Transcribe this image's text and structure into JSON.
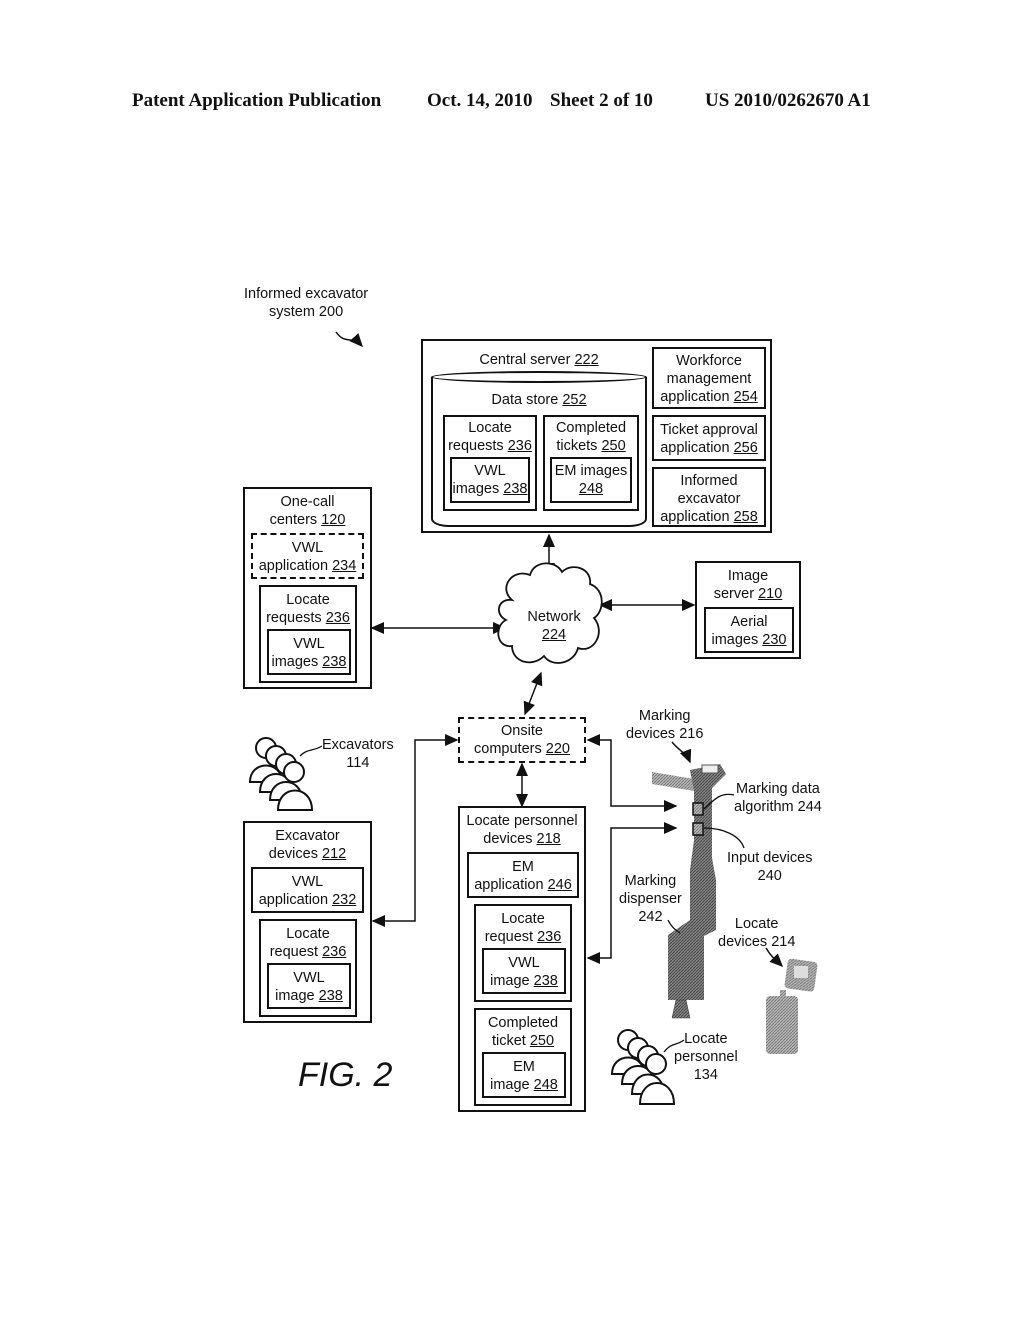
{
  "header": {
    "left": "Patent Application Publication",
    "date": "Oct. 14, 2010",
    "sheet": "Sheet 2 of 10",
    "number": "US 2010/0262670 A1"
  },
  "system_label": {
    "line1": "Informed excavator",
    "line2": "system 200"
  },
  "central_server": {
    "title": "Central server",
    "ref": "222",
    "data_store": {
      "title": "Data store",
      "ref": "252"
    },
    "locate_requests": {
      "line1": "Locate",
      "line2": "requests",
      "ref": "236"
    },
    "vwl_images": {
      "line1": "VWL",
      "line2": "images",
      "ref": "238"
    },
    "completed_tickets": {
      "line1": "Completed",
      "line2": "tickets",
      "ref": "250"
    },
    "em_images": {
      "line1": "EM images",
      "ref": "248"
    },
    "workforce": {
      "line1": "Workforce",
      "line2": "management",
      "line3": "application",
      "ref": "254"
    },
    "ticket_approval": {
      "line1": "Ticket approval",
      "line2": "application",
      "ref": "256"
    },
    "informed_excavator": {
      "line1": "Informed",
      "line2": "excavator",
      "line3": "application",
      "ref": "258"
    }
  },
  "one_call": {
    "line1": "One-call",
    "line2": "centers",
    "ref": "120",
    "vwl_app": {
      "line1": "VWL",
      "line2": "application",
      "ref": "234"
    },
    "locate_requests": {
      "line1": "Locate",
      "line2": "requests",
      "ref": "236"
    },
    "vwl_images": {
      "line1": "VWL",
      "line2": "images",
      "ref": "238"
    }
  },
  "network": {
    "line1": "Network",
    "ref": "224"
  },
  "image_server": {
    "line1": "Image",
    "line2": "server",
    "ref": "210",
    "aerial": {
      "line1": "Aerial",
      "line2": "images",
      "ref": "230"
    }
  },
  "onsite": {
    "line1": "Onsite",
    "line2": "computers",
    "ref": "220"
  },
  "excavators": {
    "line1": "Excavators",
    "line2": "114"
  },
  "excavator_devices": {
    "line1": "Excavator",
    "line2": "devices",
    "ref": "212",
    "vwl_app": {
      "line1": "VWL",
      "line2": "application",
      "ref": "232"
    },
    "locate_request": {
      "line1": "Locate",
      "line2": "request",
      "ref": "236"
    },
    "vwl_image": {
      "line1": "VWL",
      "line2": "image",
      "ref": "238"
    }
  },
  "locate_personnel_devices": {
    "line1": "Locate personnel",
    "line2": "devices",
    "ref": "218",
    "em_app": {
      "line1": "EM",
      "line2": "application",
      "ref": "246"
    },
    "locate_request": {
      "line1": "Locate",
      "line2": "request",
      "ref": "236"
    },
    "vwl_image": {
      "line1": "VWL",
      "line2": "image",
      "ref": "238"
    },
    "completed_ticket": {
      "line1": "Completed",
      "line2": "ticket",
      "ref": "250"
    },
    "em_image": {
      "line1": "EM",
      "line2": "image",
      "ref": "248"
    }
  },
  "marking_devices": {
    "line1": "Marking",
    "line2": "devices 216"
  },
  "marking_algorithm": {
    "line1": "Marking data",
    "line2": "algorithm 244"
  },
  "input_devices": {
    "line1": "Input devices",
    "line2": "240"
  },
  "marking_dispenser": {
    "line1": "Marking",
    "line2": "dispenser",
    "line3": "242"
  },
  "locate_devices": {
    "line1": "Locate",
    "line2": "devices 214"
  },
  "locate_personnel": {
    "line1": "Locate",
    "line2": "personnel",
    "line3": "134"
  },
  "figure_label": "FIG. 2"
}
